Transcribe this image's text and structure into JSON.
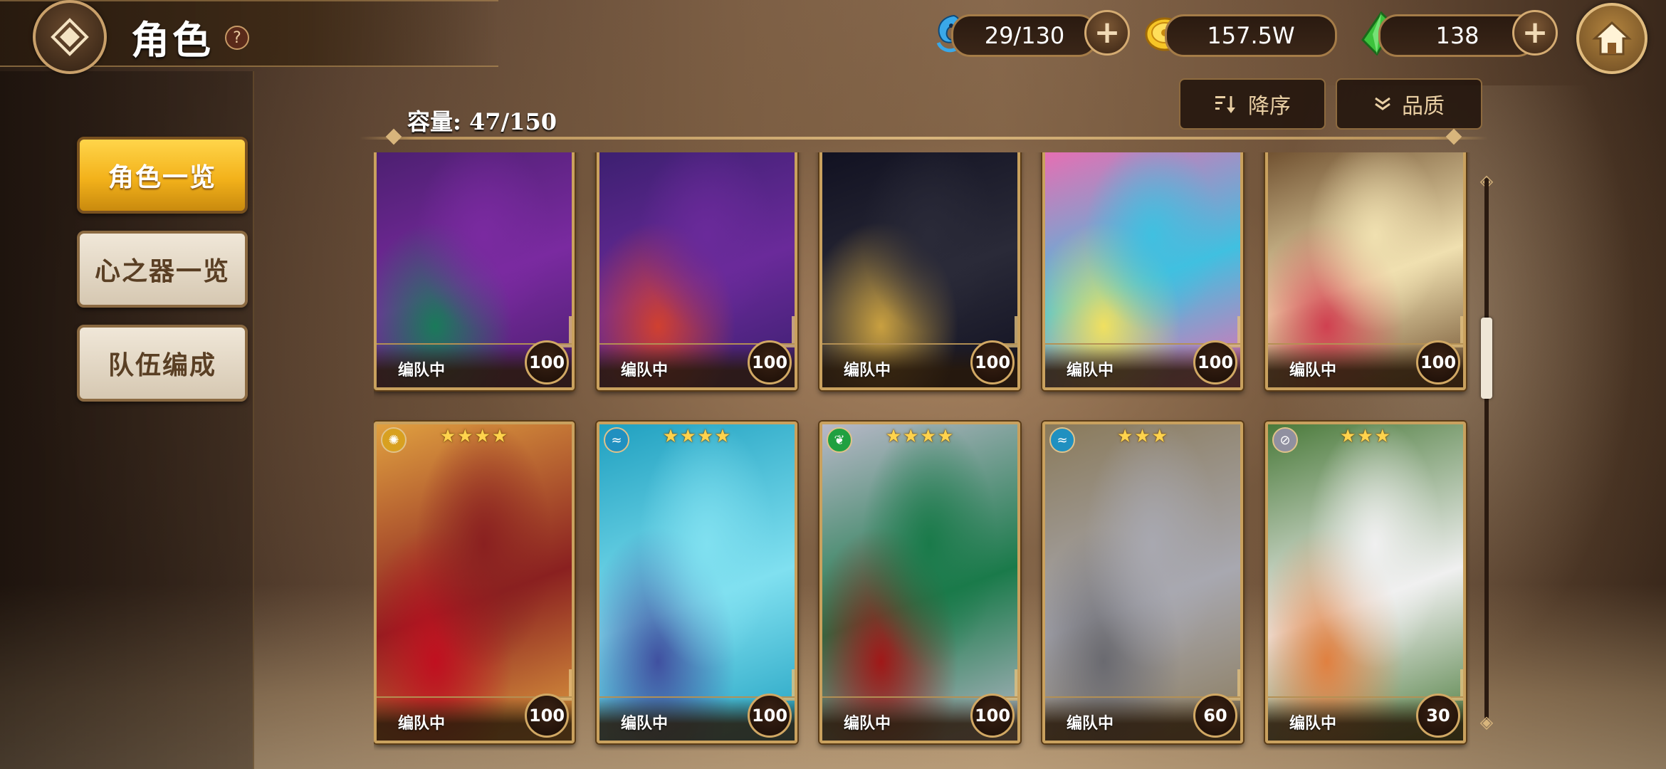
{
  "header": {
    "title": "角色",
    "help_label": "?",
    "resources": {
      "stamina": {
        "value": "29/130",
        "icon": "water-spirit-icon"
      },
      "gold": {
        "value": "157.5W",
        "icon": "gold-coin-icon"
      },
      "gems": {
        "value": "138",
        "icon": "green-crystal-icon"
      }
    },
    "plus_label": "+"
  },
  "toolbar": {
    "sort_label": "降序",
    "filter_label": "品质",
    "capacity": "容量: 47/150"
  },
  "sidebar": {
    "items": [
      {
        "label": "角色一览",
        "active": true
      },
      {
        "label": "心之器一览",
        "active": false
      },
      {
        "label": "队伍编成",
        "active": false
      }
    ]
  },
  "cards": [
    {
      "status": "编队中",
      "level": "100",
      "stars": "",
      "attr": "",
      "colors": [
        "#4a1f6e",
        "#7a2aa0",
        "#1a7a5a"
      ]
    },
    {
      "status": "编队中",
      "level": "100",
      "stars": "",
      "attr": "",
      "colors": [
        "#3a1f6e",
        "#6a2a9a",
        "#d04030"
      ]
    },
    {
      "status": "编队中",
      "level": "100",
      "stars": "",
      "attr": "",
      "colors": [
        "#101020",
        "#2a2a38",
        "#c9a040"
      ]
    },
    {
      "status": "编队中",
      "level": "100",
      "stars": "",
      "attr": "",
      "colors": [
        "#f06ab0",
        "#40c0e0",
        "#f0e060"
      ]
    },
    {
      "status": "编队中",
      "level": "100",
      "stars": "",
      "attr": "",
      "colors": [
        "#6a4a2a",
        "#f0e0b0",
        "#d04050"
      ]
    },
    {
      "status": "编队中",
      "level": "100",
      "stars": "★★★★",
      "attr": "✺",
      "attrColor": "#d8a020",
      "colors": [
        "#e0a040",
        "#8a2020",
        "#c01020"
      ]
    },
    {
      "status": "编队中",
      "level": "100",
      "stars": "★★★★",
      "attr": "≈",
      "attrColor": "#2090c0",
      "colors": [
        "#20a0c0",
        "#80e0f0",
        "#4050a0"
      ]
    },
    {
      "status": "编队中",
      "level": "100",
      "stars": "★★★★",
      "attr": "❦",
      "attrColor": "#20a040",
      "colors": [
        "#b8b8c8",
        "#1a7a4a",
        "#a01818"
      ]
    },
    {
      "status": "编队中",
      "level": "60",
      "stars": "★★★",
      "attr": "≈",
      "attrColor": "#2090c0",
      "colors": [
        "#8a7a5a",
        "#a8a8b0",
        "#6a6a70"
      ]
    },
    {
      "status": "编队中",
      "level": "30",
      "stars": "★★★",
      "attr": "⊘",
      "attrColor": "#9090a0",
      "colors": [
        "#4a7a3a",
        "#f0f0f0",
        "#e08040"
      ]
    }
  ],
  "scrollbar": {
    "position": 0.26
  }
}
